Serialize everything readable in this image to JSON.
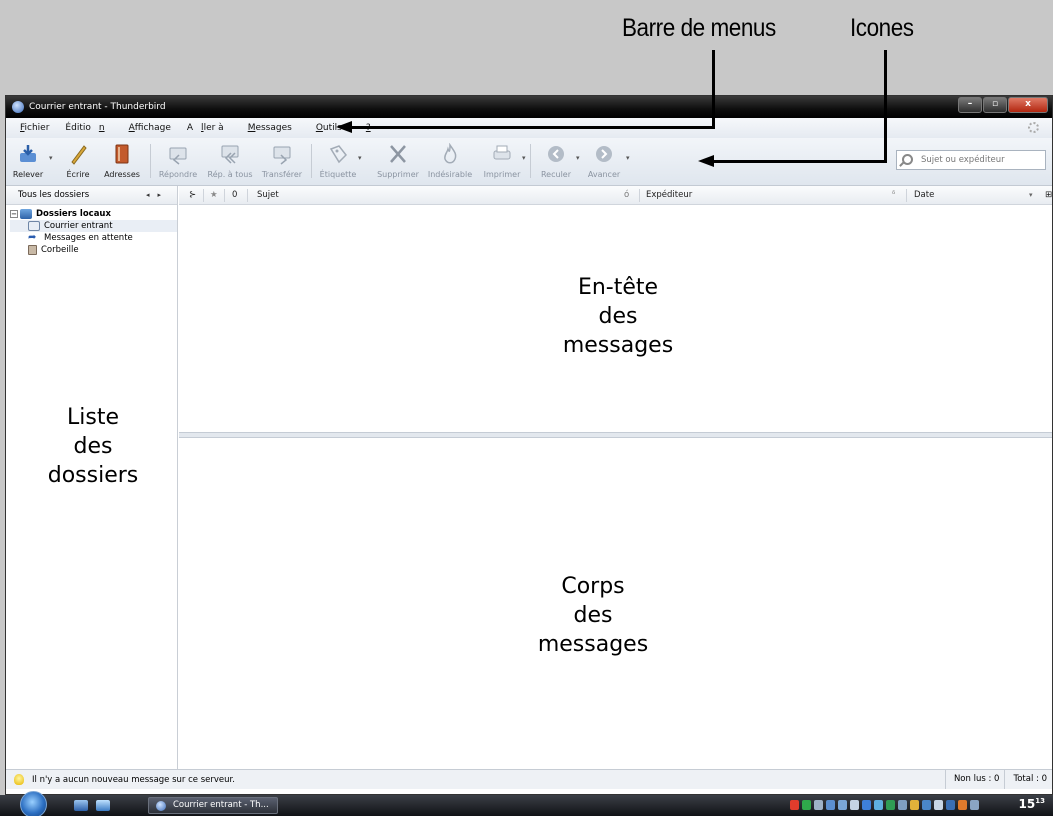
{
  "annotations": {
    "menubar_label": "Barre de menus",
    "icons_label": "Icones",
    "folder_list": [
      "Liste",
      "des",
      "dossiers"
    ],
    "message_header": [
      "En-tête",
      "des",
      "messages"
    ],
    "message_body": [
      "Corps",
      "des",
      "messages"
    ]
  },
  "window": {
    "title": "Courrier entrant - Thunderbird",
    "controls": {
      "minimize": "–",
      "maximize": "▫",
      "close": "x"
    }
  },
  "menubar": {
    "items": [
      {
        "pre": "",
        "u": "F",
        "post": "ichier"
      },
      {
        "pre": "Éditio",
        "u": "n",
        "post": ""
      },
      {
        "pre": "",
        "u": "A",
        "post": "ffichage"
      },
      {
        "pre": "A",
        "u": "l",
        "post": "ler à"
      },
      {
        "pre": "",
        "u": "M",
        "post": "essages"
      },
      {
        "pre": "",
        "u": "O",
        "post": "utils"
      },
      {
        "pre": "",
        "u": "?",
        "post": ""
      }
    ]
  },
  "toolbar": {
    "relever": "Relever",
    "ecrire": "Écrire",
    "adresses": "Adresses",
    "repondre": "Répondre",
    "rep_tous": "Rép. à tous",
    "transferer": "Transférer",
    "etiquette": "Étiquette",
    "supprimer": "Supprimer",
    "indesirable": "Indésirable",
    "imprimer": "Imprimer",
    "reculer": "Reculer",
    "avancer": "Avancer",
    "search_placeholder": "Sujet ou expéditeur"
  },
  "folders": {
    "header": "Tous les dossiers",
    "root": "Dossiers locaux",
    "items": [
      "Courrier entrant",
      "Messages en attente",
      "Corbeille"
    ]
  },
  "columns": {
    "subject": "Sujet",
    "sender": "Expéditeur",
    "date": "Date"
  },
  "status": {
    "message": "Il n'y a aucun nouveau message sur ce serveur.",
    "unread": "Non lus : 0",
    "total": "Total : 0"
  },
  "taskbar": {
    "task_label": "Courrier entrant - Th...",
    "clock_hour": "15",
    "clock_min": "13"
  },
  "colors": {
    "title_bar": "#000000",
    "background": "#c8c8c8",
    "toolbar": "#e6ecf3"
  }
}
